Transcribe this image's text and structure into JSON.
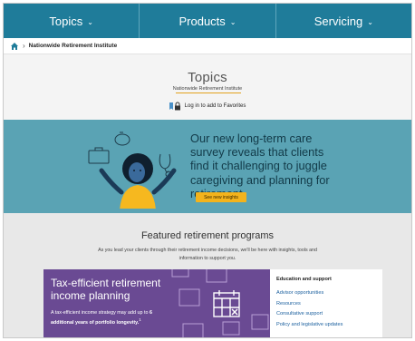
{
  "nav": {
    "items": [
      {
        "label": "Topics"
      },
      {
        "label": "Products"
      },
      {
        "label": "Servicing"
      }
    ]
  },
  "breadcrumb": {
    "current": "Nationwide Retirement Institute"
  },
  "header": {
    "title": "Topics",
    "subtitle": "Nationwide Retirement Institute",
    "favorites_label": "Log in to add to Favorites"
  },
  "hero": {
    "text": "Our new long-term care survey reveals that clients find it challenging to juggle caregiving and planning for retirement.",
    "cta_label": "See new insights"
  },
  "featured": {
    "title": "Featured retirement programs",
    "description_line1": "As you lead your clients through their retirement income decisions, we'll be here with insights, tools and",
    "description_line2": "information to support you.",
    "promo": {
      "title": "Tax-efficient retirement income planning",
      "desc_prefix": "A tax-efficient income strategy may add up to ",
      "desc_bold": "6 additional years of portfolio longevity.",
      "desc_sup": "1"
    },
    "side": {
      "heading": "Education and support",
      "links": [
        {
          "label": "Advisor opportunities"
        },
        {
          "label": "Resources"
        },
        {
          "label": "Consultative support"
        },
        {
          "label": "Policy and legislative updates"
        }
      ]
    }
  },
  "colors": {
    "nav_bg": "#1f7c9a",
    "hero_bg": "#5aa3b4",
    "cta_bg": "#f3b31c",
    "promo_bg": "#6a4a93",
    "link": "#1a5f9e"
  }
}
